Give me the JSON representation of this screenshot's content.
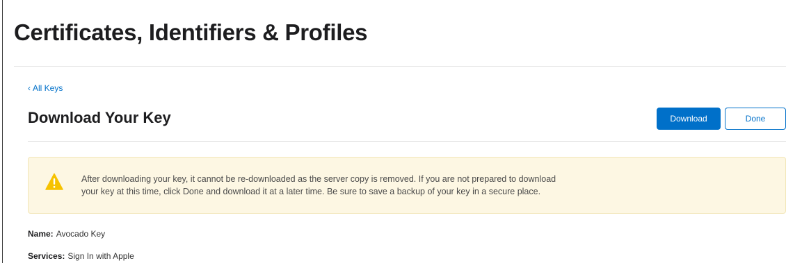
{
  "header": {
    "title": "Certificates, Identifiers & Profiles"
  },
  "nav": {
    "back_chevron": "‹",
    "back_label": "All Keys"
  },
  "section": {
    "title": "Download Your Key"
  },
  "actions": {
    "download_label": "Download",
    "done_label": "Done"
  },
  "warning": {
    "icon": "warning-triangle-icon",
    "line1": "After downloading your key, it cannot be re-downloaded as the server copy is removed. If you are not prepared to download",
    "line2": "your key at this time, click Done and download it at a later time. Be sure to save a backup of your key in a secure place."
  },
  "details": {
    "name_label": "Name:",
    "name_value": "Avocado Key",
    "services_label": "Services:",
    "services_value": "Sign In with Apple"
  },
  "colors": {
    "accent": "#0070c9",
    "warning_bg": "#fdf7e3",
    "warning_icon": "#f6c200"
  }
}
